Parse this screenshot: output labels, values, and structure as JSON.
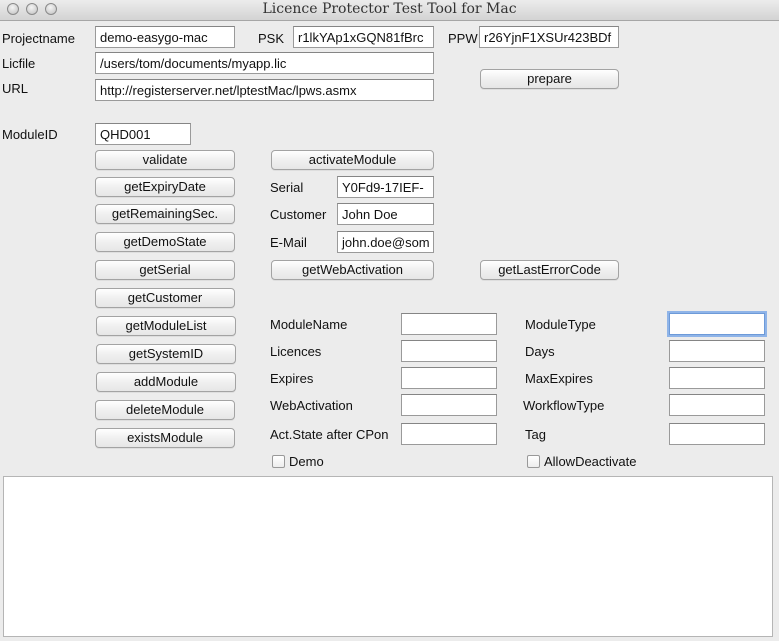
{
  "window": {
    "title": "Licence Protector Test Tool for Mac"
  },
  "project": {
    "projectname_label": "Projectname",
    "projectname_value": "demo-easygo-mac",
    "psk_label": "PSK",
    "psk_value": "r1lkYAp1xGQN81fBrc",
    "ppw_label": "PPW",
    "ppw_value": "r26YjnF1XSUr423BDf",
    "licfile_label": "Licfile",
    "licfile_value": "/users/tom/documents/myapp.lic",
    "url_label": "URL",
    "url_value": "http://registerserver.net/lptestMac/lpws.asmx",
    "prepare_button": "prepare"
  },
  "module": {
    "moduleid_label": "ModuleID",
    "moduleid_value": "QHD001"
  },
  "actions": [
    "validate",
    "getExpiryDate",
    "getRemainingSec.",
    "getDemoState",
    "getSerial",
    "getCustomer",
    "getModuleList",
    "getSystemID",
    "addModule",
    "deleteModule",
    "existsModule"
  ],
  "activation": {
    "activate_button": "activateModule",
    "serial_label": "Serial",
    "serial_value": "Y0Fd9-17IEF-",
    "customer_label": "Customer",
    "customer_value": "John Doe",
    "email_label": "E-Mail",
    "email_value": "john.doe@som",
    "web_activation_button": "getWebActivation",
    "last_error_button": "getLastErrorCode"
  },
  "module_fields": {
    "left": [
      {
        "label": "ModuleName",
        "value": ""
      },
      {
        "label": "Licences",
        "value": ""
      },
      {
        "label": "Expires",
        "value": ""
      },
      {
        "label": "WebActivation",
        "value": ""
      },
      {
        "label": "Act.State after CPon",
        "value": ""
      }
    ],
    "right": [
      {
        "label": "ModuleType",
        "value": ""
      },
      {
        "label": "Days",
        "value": ""
      },
      {
        "label": "MaxExpires",
        "value": ""
      },
      {
        "label": "WorkflowType",
        "value": ""
      },
      {
        "label": "Tag",
        "value": ""
      }
    ],
    "demo_checkbox": {
      "label": "Demo",
      "checked": false
    },
    "allow_deactivate_checkbox": {
      "label": "AllowDeactivate",
      "checked": false
    }
  },
  "output": {
    "text": ""
  }
}
